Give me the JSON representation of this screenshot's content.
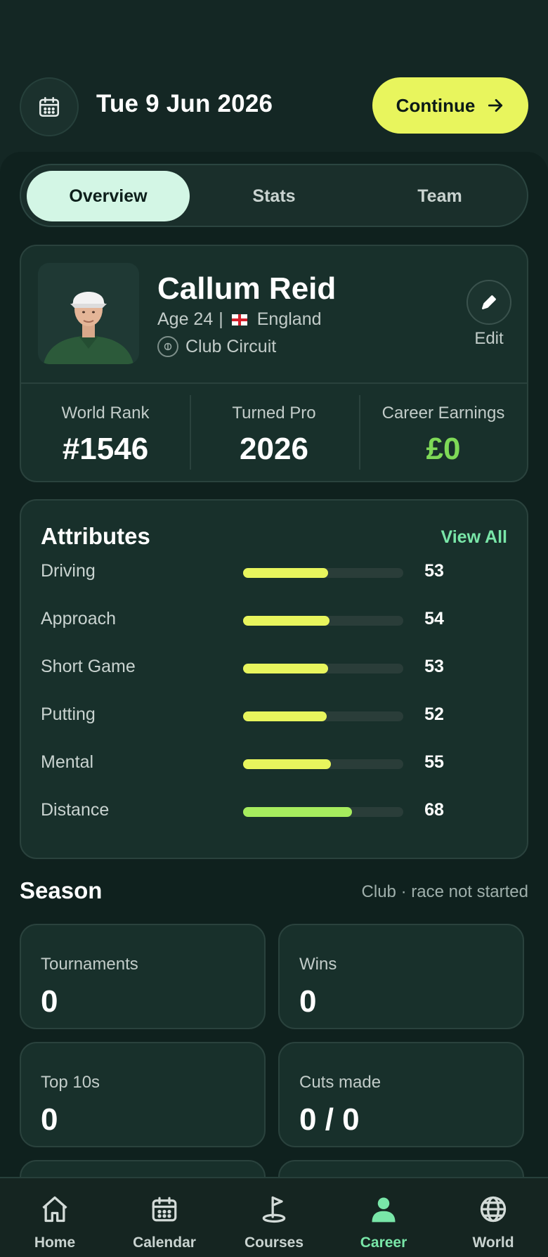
{
  "header": {
    "date": "Tue 9 Jun 2026",
    "continue_label": "Continue"
  },
  "tabs": [
    {
      "label": "Overview",
      "active": true
    },
    {
      "label": "Stats",
      "active": false
    },
    {
      "label": "Team",
      "active": false
    }
  ],
  "profile": {
    "name": "Callum Reid",
    "age": "Age 24",
    "country": "England",
    "tour": "Club Circuit",
    "edit_label": "Edit",
    "stats": [
      {
        "label": "World Rank",
        "value": "#1546",
        "color": "#ffffff"
      },
      {
        "label": "Turned Pro",
        "value": "2026",
        "color": "#ffffff"
      },
      {
        "label": "Career Earnings",
        "value": "£0",
        "color": "#7ed957"
      }
    ]
  },
  "attributes": {
    "title": "Attributes",
    "view_all": "View All",
    "items": [
      {
        "name": "Driving",
        "value": "53",
        "level": 0.53,
        "color": "#e8f55d"
      },
      {
        "name": "Approach",
        "value": "54",
        "level": 0.54,
        "color": "#e8f55d"
      },
      {
        "name": "Short Game",
        "value": "53",
        "level": 0.53,
        "color": "#e8f55d"
      },
      {
        "name": "Putting",
        "value": "52",
        "level": 0.52,
        "color": "#e8f55d"
      },
      {
        "name": "Mental",
        "value": "55",
        "level": 0.55,
        "color": "#e8f55d"
      },
      {
        "name": "Distance",
        "value": "68",
        "level": 0.68,
        "color": "#a6ec5e"
      }
    ]
  },
  "season": {
    "title": "Season",
    "subtitle": "Club · race not started",
    "cards": [
      {
        "label": "Tournaments",
        "value": "0"
      },
      {
        "label": "Wins",
        "value": "0"
      },
      {
        "label": "Top 10s",
        "value": "0"
      },
      {
        "label": "Cuts made",
        "value": "0 / 0"
      }
    ]
  },
  "nav": [
    {
      "label": "Home",
      "icon": "home-icon",
      "active": false
    },
    {
      "label": "Calendar",
      "icon": "calendar-icon",
      "active": false
    },
    {
      "label": "Courses",
      "icon": "flag-icon",
      "active": false
    },
    {
      "label": "Career",
      "icon": "person-icon",
      "active": true
    },
    {
      "label": "World",
      "icon": "globe-icon",
      "active": false
    }
  ],
  "colors": {
    "accent": "#e8f55d",
    "active_green": "#79e6a8",
    "earnings_green": "#7ed957",
    "background": "#0f211e"
  }
}
